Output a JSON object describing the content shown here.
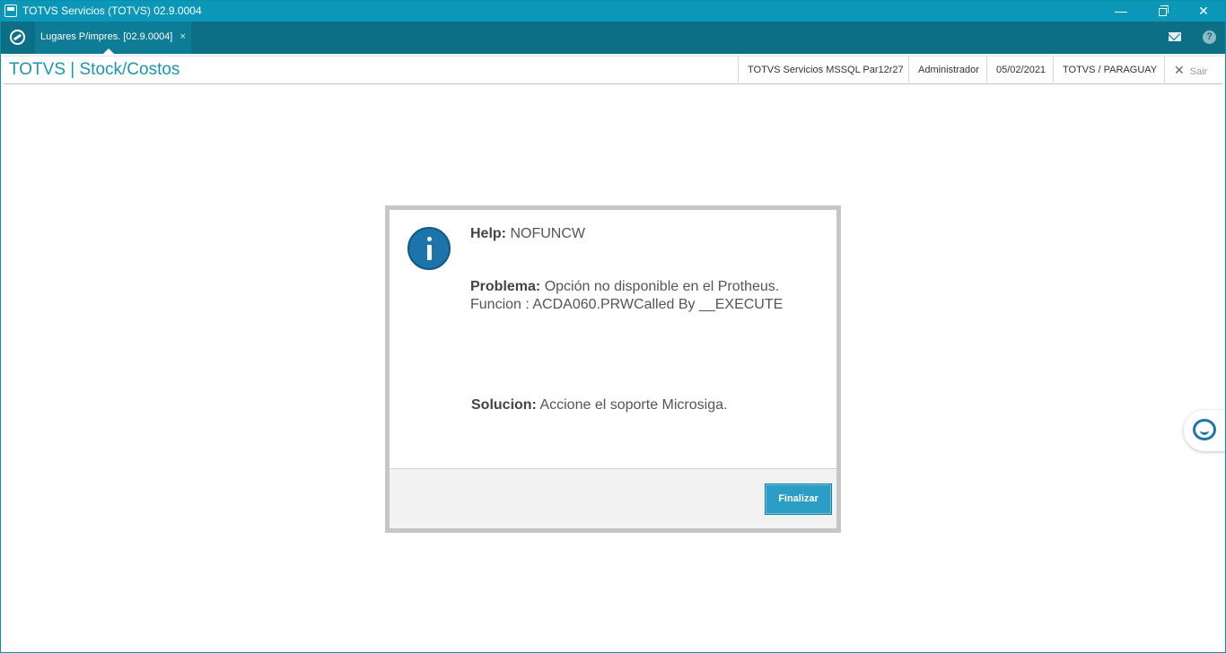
{
  "window": {
    "title": "TOTVS Servicios (TOTVS) 02.9.0004",
    "minimize_glyph": "—",
    "close_glyph": "✕"
  },
  "tabs": [
    {
      "label": "Lugares P/impres. [02.9.0004]",
      "close_glyph": "×"
    }
  ],
  "tabbar_icons": {
    "help_glyph": "?"
  },
  "header": {
    "module_title": "TOTVS | Stock/Costos",
    "server": "TOTVS Servicios MSSQL Par12r27",
    "user": "Administrador",
    "date": "05/02/2021",
    "company": "TOTVS / PARAGUAY",
    "logout_label": "Sair",
    "logout_glyph": "✕"
  },
  "dialog": {
    "help_label": "Help:",
    "help_value": "NOFUNCW",
    "problem_label": "Problema:",
    "problem_value": "Opción no disponible en el Protheus.",
    "problem_line2": "Funcion : ACDA060.PRWCalled By __EXECUTE",
    "solution_label": "Solucion:",
    "solution_value": "Accione el soporte Microsiga.",
    "finalize_button": "Finalizar"
  },
  "icons": {
    "app": "window-icon",
    "logo": "totvs-logo-icon",
    "mail": "mail-icon",
    "help": "help-icon",
    "info": "info-icon",
    "chat": "chat-assistant-icon"
  }
}
